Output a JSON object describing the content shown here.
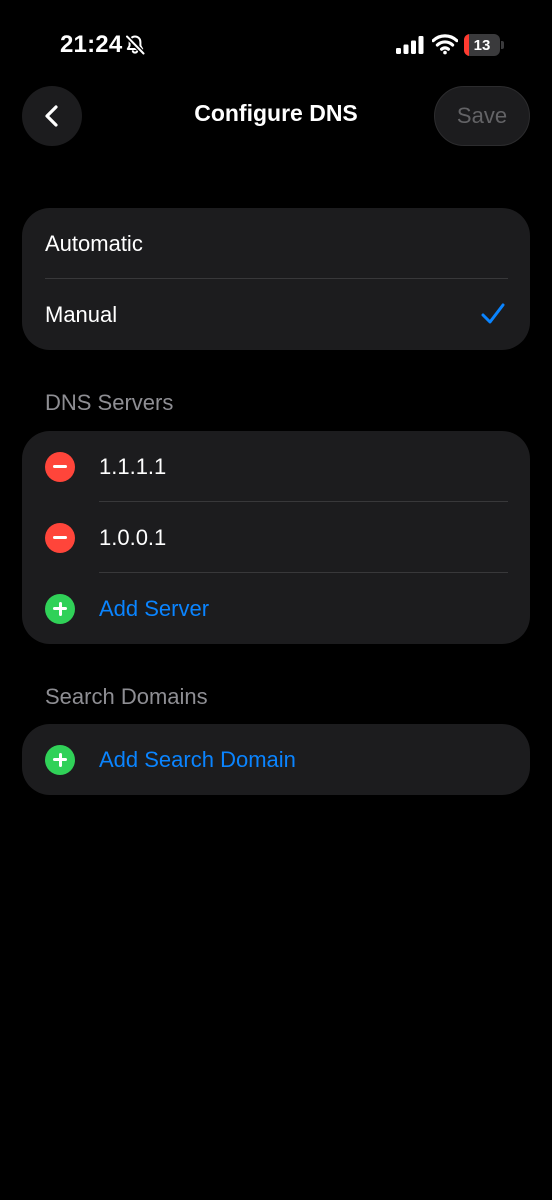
{
  "status_bar": {
    "time": "21:24",
    "battery_level": "13",
    "battery_fraction": 0.13,
    "icons": [
      "bell-slash-icon",
      "cellular-signal-icon",
      "wifi-icon",
      "battery-icon"
    ]
  },
  "nav": {
    "back_icon": "chevron-left-icon",
    "title": "Configure DNS",
    "save_label": "Save"
  },
  "mode": {
    "options": [
      {
        "label": "Automatic",
        "selected": false
      },
      {
        "label": "Manual",
        "selected": true
      }
    ]
  },
  "dns_servers": {
    "header": "DNS Servers",
    "servers": [
      "1.1.1.1",
      "1.0.0.1"
    ],
    "add_label": "Add Server"
  },
  "search_domains": {
    "header": "Search Domains",
    "add_label": "Add Search Domain"
  },
  "colors": {
    "background": "#000000",
    "group_background": "#1c1c1e",
    "accent": "#0a84ff",
    "remove": "#ff453a",
    "add": "#30d158",
    "secondary_text": "#8e8e93",
    "disabled_text": "#636366"
  }
}
